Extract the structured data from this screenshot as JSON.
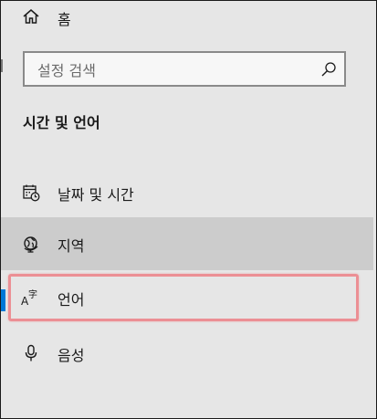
{
  "nav": {
    "home": {
      "label": "홈",
      "icon": "home-icon"
    }
  },
  "search": {
    "placeholder": "설정 검색",
    "icon": "search-icon"
  },
  "section": {
    "title": "시간 및 언어"
  },
  "items": [
    {
      "label": "날짜 및 시간",
      "icon": "calendar-clock-icon",
      "selected": false
    },
    {
      "label": "지역",
      "icon": "globe-icon",
      "selected": false,
      "hovered": true
    },
    {
      "label": "언어",
      "icon": "language-icon",
      "selected": true
    },
    {
      "label": "음성",
      "icon": "microphone-icon",
      "selected": false
    }
  ],
  "colors": {
    "background": "#e6e6e6",
    "hover": "#cccccc",
    "accent": "#0078d7",
    "highlight": "#ec8f94"
  }
}
